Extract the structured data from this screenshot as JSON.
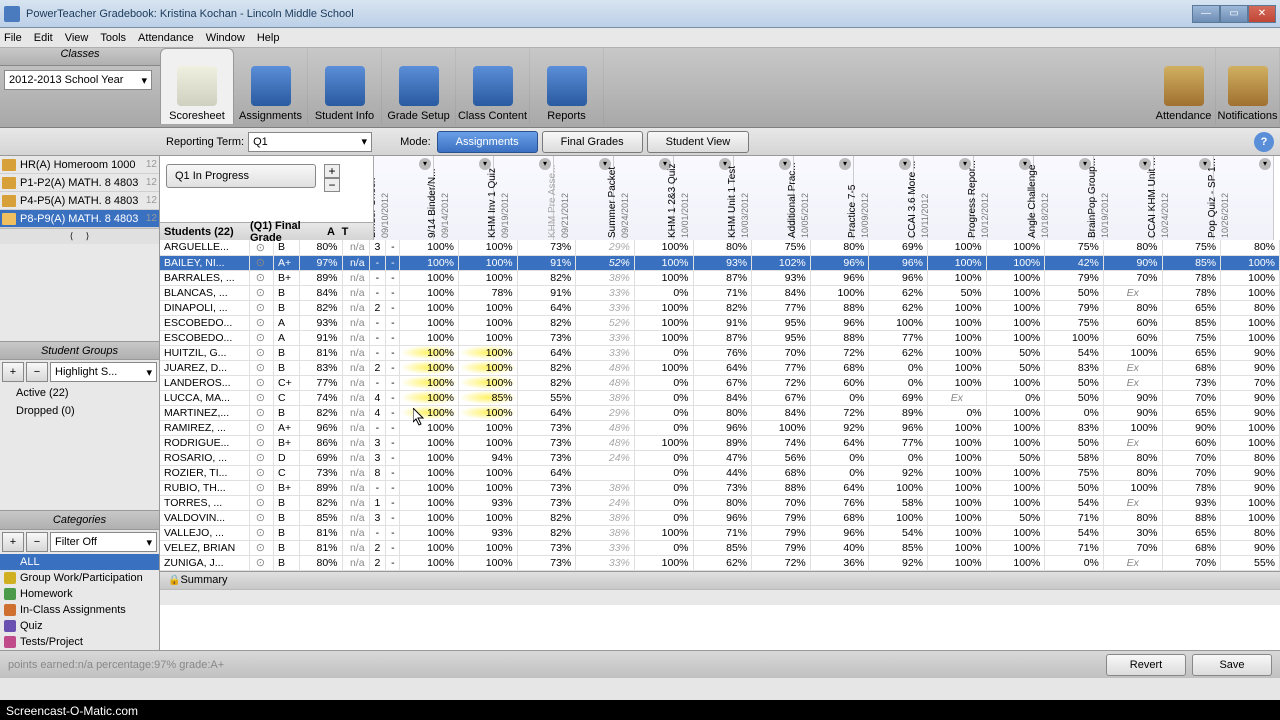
{
  "window": {
    "title": "PowerTeacher Gradebook: Kristina Kochan - Lincoln Middle School"
  },
  "menus": [
    "File",
    "Edit",
    "View",
    "Tools",
    "Attendance",
    "Window",
    "Help"
  ],
  "left_header": "Classes",
  "year": "2012-2013 School Year",
  "classes": [
    {
      "label": "HR(A) Homeroom 1000",
      "hint": "12"
    },
    {
      "label": "P1-P2(A) MATH. 8 4803",
      "hint": "12"
    },
    {
      "label": "P4-P5(A) MATH. 8 4803",
      "hint": "12"
    },
    {
      "label": "P8-P9(A) MATH. 8 4803",
      "hint": "12",
      "selected": true
    }
  ],
  "student_groups_header": "Student Groups",
  "highlight": "Highlight S...",
  "groups": [
    {
      "label": "Active (22)"
    },
    {
      "label": "Dropped (0)"
    }
  ],
  "categories_header": "Categories",
  "filter": "Filter Off",
  "categories": [
    {
      "label": "ALL",
      "color": "#3a70c0",
      "all": true
    },
    {
      "label": "Group Work/Participation",
      "color": "#d0b020"
    },
    {
      "label": "Homework",
      "color": "#4a9a4a"
    },
    {
      "label": "In-Class Assignments",
      "color": "#d07030"
    },
    {
      "label": "Quiz",
      "color": "#6a50b0"
    },
    {
      "label": "Tests/Project",
      "color": "#c04a8a"
    }
  ],
  "toolbar": [
    {
      "label": "Scoresheet",
      "active": true
    },
    {
      "label": "Assignments"
    },
    {
      "label": "Student Info"
    },
    {
      "label": "Grade Setup"
    },
    {
      "label": "Class Content"
    },
    {
      "label": "Reports"
    }
  ],
  "right_tools": [
    {
      "label": "Attendance"
    },
    {
      "label": "Notifications"
    }
  ],
  "reporting_label": "Reporting Term:",
  "reporting_value": "Q1",
  "mode_label": "Mode:",
  "modes": [
    {
      "label": "Assignments",
      "active": true
    },
    {
      "label": "Final Grades"
    },
    {
      "label": "Student View"
    }
  ],
  "qprogress": "Q1 In Progress",
  "students_header": "Students (22)",
  "final_header": "(Q1) Final Grade",
  "col_A": "A",
  "col_T": "T",
  "assignments": [
    {
      "name": "Binder Check",
      "date": "09/10/2012"
    },
    {
      "name": "9/14  Binder/N...",
      "date": "09/14/2012"
    },
    {
      "name": "KHM Inv 1 Quiz",
      "date": "09/19/2012"
    },
    {
      "name": "KHM Pre Asse...",
      "date": "09/21/2012",
      "grey": true
    },
    {
      "name": "Summer Packet",
      "date": "09/24/2012"
    },
    {
      "name": "KHM 1 2&3 Quiz",
      "date": "10/01/2012"
    },
    {
      "name": "KHM Unit 1 Test",
      "date": "10/03/2012"
    },
    {
      "name": "Additional Prac...",
      "date": "10/05/2012"
    },
    {
      "name": "Practice 7-5",
      "date": "10/09/2012"
    },
    {
      "name": "CCAI 3.6 More ...",
      "date": "10/11/2012"
    },
    {
      "name": "Progress Repor...",
      "date": "10/12/2012"
    },
    {
      "name": "Angle Challenge",
      "date": "10/18/2012"
    },
    {
      "name": "BrainPop Group...",
      "date": "10/19/2012"
    },
    {
      "name": "CCAI KHM Unit ...",
      "date": "10/24/2012"
    },
    {
      "name": "Pop Quiz - SP 1...",
      "date": "10/26/2012"
    }
  ],
  "students": [
    {
      "name": "ARGUELLE...",
      "g": "B",
      "p": "80%",
      "na": "n/a",
      "a": "3",
      "t": "-",
      "s": [
        "100%",
        "100%",
        "73%",
        "29%",
        "100%",
        "80%",
        "75%",
        "80%",
        "69%",
        "100%",
        "100%",
        "75%",
        "80%",
        "75%",
        "80%"
      ]
    },
    {
      "name": "BAILEY, NI...",
      "g": "A+",
      "p": "97%",
      "na": "n/a",
      "a": "-",
      "t": "-",
      "sel": true,
      "s": [
        "100%",
        "100%",
        "91%",
        "52%",
        "100%",
        "93%",
        "102%",
        "96%",
        "96%",
        "100%",
        "100%",
        "42%",
        "90%",
        "85%",
        "100%"
      ]
    },
    {
      "name": "BARRALES, ...",
      "g": "B+",
      "p": "89%",
      "na": "n/a",
      "a": "-",
      "t": "-",
      "s": [
        "100%",
        "100%",
        "82%",
        "38%",
        "100%",
        "87%",
        "93%",
        "96%",
        "96%",
        "100%",
        "100%",
        "79%",
        "70%",
        "78%",
        "100%"
      ]
    },
    {
      "name": "BLANCAS, ...",
      "g": "B",
      "p": "84%",
      "na": "n/a",
      "a": "-",
      "t": "-",
      "s": [
        "100%",
        "78%",
        "91%",
        "33%",
        "0%",
        "71%",
        "84%",
        "100%",
        "62%",
        "50%",
        "100%",
        "50%",
        "Ex",
        "78%",
        "100%"
      ]
    },
    {
      "name": "DINAPOLI, ...",
      "g": "B",
      "p": "82%",
      "na": "n/a",
      "a": "2",
      "t": "-",
      "s": [
        "100%",
        "100%",
        "64%",
        "33%",
        "100%",
        "82%",
        "77%",
        "88%",
        "62%",
        "100%",
        "100%",
        "79%",
        "80%",
        "65%",
        "80%"
      ]
    },
    {
      "name": "ESCOBEDO...",
      "g": "A",
      "p": "93%",
      "na": "n/a",
      "a": "-",
      "t": "-",
      "s": [
        "100%",
        "100%",
        "82%",
        "52%",
        "100%",
        "91%",
        "95%",
        "96%",
        "100%",
        "100%",
        "100%",
        "75%",
        "60%",
        "85%",
        "100%"
      ]
    },
    {
      "name": "ESCOBEDO...",
      "g": "A",
      "p": "91%",
      "na": "n/a",
      "a": "-",
      "t": "-",
      "s": [
        "100%",
        "100%",
        "73%",
        "33%",
        "100%",
        "87%",
        "95%",
        "88%",
        "77%",
        "100%",
        "100%",
        "100%",
        "60%",
        "75%",
        "100%"
      ]
    },
    {
      "name": "HUITZIL, G...",
      "g": "B",
      "p": "81%",
      "na": "n/a",
      "a": "-",
      "t": "-",
      "s": [
        "100%",
        "100%",
        "64%",
        "33%",
        "0%",
        "76%",
        "70%",
        "72%",
        "62%",
        "100%",
        "50%",
        "54%",
        "100%",
        "65%",
        "90%"
      ]
    },
    {
      "name": "JUAREZ, D...",
      "g": "B",
      "p": "83%",
      "na": "n/a",
      "a": "2",
      "t": "-",
      "s": [
        "100%",
        "100%",
        "82%",
        "48%",
        "100%",
        "64%",
        "77%",
        "68%",
        "0%",
        "100%",
        "50%",
        "83%",
        "Ex",
        "68%",
        "90%"
      ]
    },
    {
      "name": "LANDEROS...",
      "g": "C+",
      "p": "77%",
      "na": "n/a",
      "a": "-",
      "t": "-",
      "s": [
        "100%",
        "100%",
        "82%",
        "48%",
        "0%",
        "67%",
        "72%",
        "60%",
        "0%",
        "100%",
        "100%",
        "50%",
        "Ex",
        "73%",
        "70%"
      ]
    },
    {
      "name": "LUCCA, MA...",
      "g": "C",
      "p": "74%",
      "na": "n/a",
      "a": "4",
      "t": "-",
      "s": [
        "100%",
        "85%",
        "55%",
        "38%",
        "0%",
        "84%",
        "67%",
        "0%",
        "69%",
        "Ex",
        "0%",
        "50%",
        "90%",
        "70%",
        "90%"
      ]
    },
    {
      "name": "MARTINEZ,...",
      "g": "B",
      "p": "82%",
      "na": "n/a",
      "a": "4",
      "t": "-",
      "s": [
        "100%",
        "100%",
        "64%",
        "29%",
        "0%",
        "80%",
        "84%",
        "72%",
        "89%",
        "0%",
        "100%",
        "0%",
        "90%",
        "65%",
        "90%"
      ]
    },
    {
      "name": "RAMIREZ, ...",
      "g": "A+",
      "p": "96%",
      "na": "n/a",
      "a": "-",
      "t": "-",
      "s": [
        "100%",
        "100%",
        "73%",
        "48%",
        "0%",
        "96%",
        "100%",
        "92%",
        "96%",
        "100%",
        "100%",
        "83%",
        "100%",
        "90%",
        "100%"
      ]
    },
    {
      "name": "RODRIGUE...",
      "g": "B+",
      "p": "86%",
      "na": "n/a",
      "a": "3",
      "t": "-",
      "s": [
        "100%",
        "100%",
        "73%",
        "48%",
        "100%",
        "89%",
        "74%",
        "64%",
        "77%",
        "100%",
        "100%",
        "50%",
        "Ex",
        "60%",
        "100%"
      ]
    },
    {
      "name": "ROSARIO, ...",
      "g": "D",
      "p": "69%",
      "na": "n/a",
      "a": "3",
      "t": "-",
      "s": [
        "100%",
        "94%",
        "73%",
        "24%",
        "0%",
        "47%",
        "56%",
        "0%",
        "0%",
        "100%",
        "50%",
        "58%",
        "80%",
        "70%",
        "80%"
      ]
    },
    {
      "name": "ROZIER, TI...",
      "g": "C",
      "p": "73%",
      "na": "n/a",
      "a": "8",
      "t": "-",
      "s": [
        "100%",
        "100%",
        "64%",
        "",
        "0%",
        "44%",
        "68%",
        "0%",
        "92%",
        "100%",
        "100%",
        "75%",
        "80%",
        "70%",
        "90%"
      ]
    },
    {
      "name": "RUBIO, TH...",
      "g": "B+",
      "p": "89%",
      "na": "n/a",
      "a": "-",
      "t": "-",
      "s": [
        "100%",
        "100%",
        "73%",
        "38%",
        "0%",
        "73%",
        "88%",
        "64%",
        "100%",
        "100%",
        "100%",
        "50%",
        "100%",
        "78%",
        "90%"
      ]
    },
    {
      "name": "TORRES, ...",
      "g": "B",
      "p": "82%",
      "na": "n/a",
      "a": "1",
      "t": "-",
      "s": [
        "100%",
        "93%",
        "73%",
        "24%",
        "0%",
        "80%",
        "70%",
        "76%",
        "58%",
        "100%",
        "100%",
        "54%",
        "Ex",
        "93%",
        "100%"
      ]
    },
    {
      "name": "VALDOVIN...",
      "g": "B",
      "p": "85%",
      "na": "n/a",
      "a": "3",
      "t": "-",
      "s": [
        "100%",
        "100%",
        "82%",
        "38%",
        "0%",
        "96%",
        "79%",
        "68%",
        "100%",
        "100%",
        "50%",
        "71%",
        "80%",
        "88%",
        "100%"
      ]
    },
    {
      "name": "VALLEJO, ...",
      "g": "B",
      "p": "81%",
      "na": "n/a",
      "a": "-",
      "t": "-",
      "s": [
        "100%",
        "93%",
        "82%",
        "38%",
        "100%",
        "71%",
        "79%",
        "96%",
        "54%",
        "100%",
        "100%",
        "54%",
        "30%",
        "65%",
        "80%"
      ]
    },
    {
      "name": "VELEZ, BRIAN",
      "g": "B",
      "p": "81%",
      "na": "n/a",
      "a": "2",
      "t": "-",
      "s": [
        "100%",
        "100%",
        "73%",
        "33%",
        "0%",
        "85%",
        "79%",
        "40%",
        "85%",
        "100%",
        "100%",
        "71%",
        "70%",
        "68%",
        "90%"
      ]
    },
    {
      "name": "ZUNIGA, J...",
      "g": "B",
      "p": "80%",
      "na": "n/a",
      "a": "2",
      "t": "-",
      "s": [
        "100%",
        "100%",
        "73%",
        "33%",
        "100%",
        "62%",
        "72%",
        "36%",
        "92%",
        "100%",
        "100%",
        "0%",
        "Ex",
        "70%",
        "55%"
      ]
    }
  ],
  "summary_label": "Summary",
  "status_text": "points earned:n/a   percentage:97%   grade:A+",
  "revert": "Revert",
  "save": "Save",
  "watermark": "Screencast-O-Matic.com"
}
